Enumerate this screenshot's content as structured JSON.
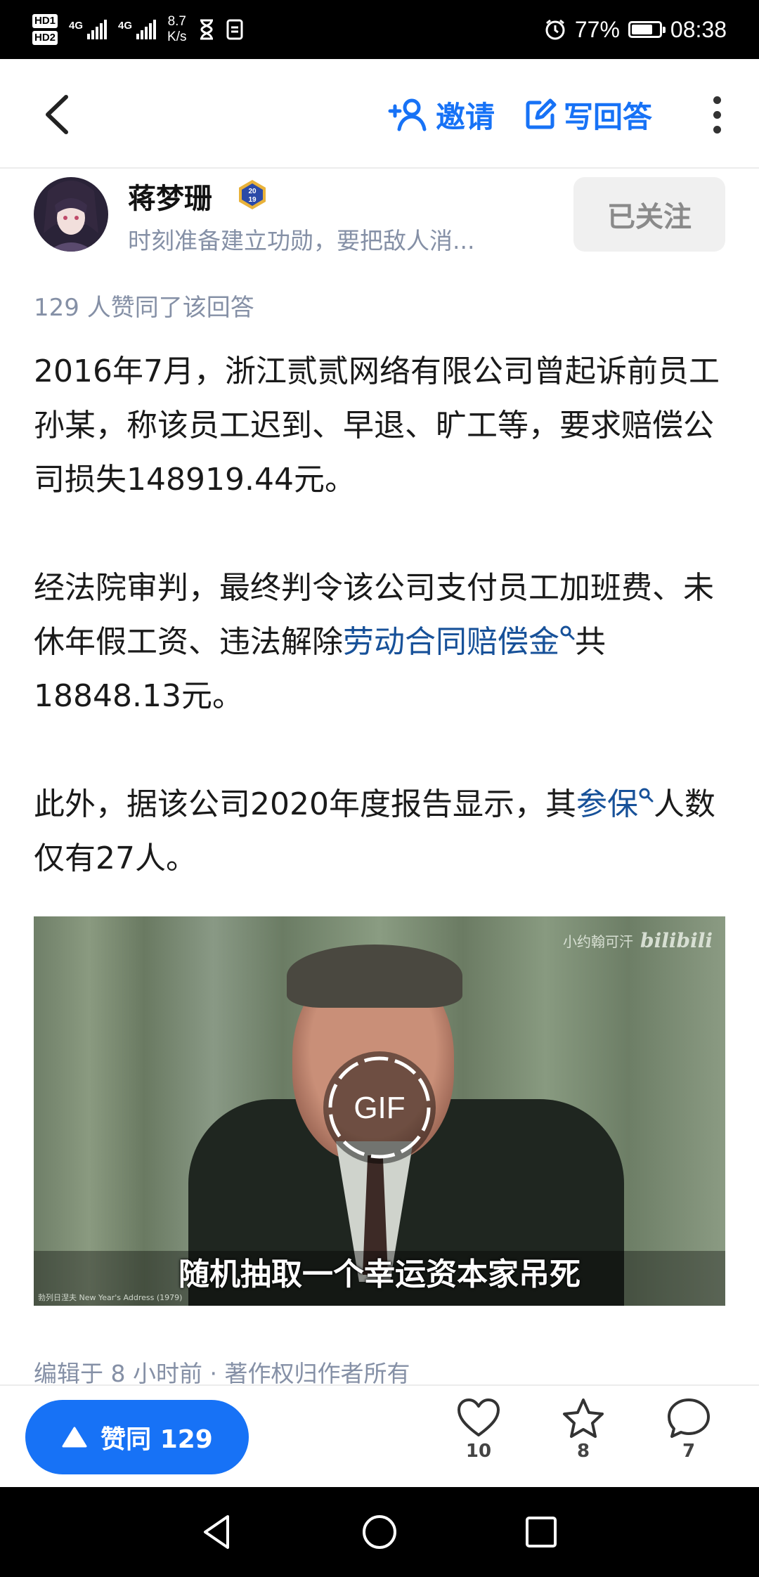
{
  "status_bar": {
    "hd1": "HD1",
    "hd2": "HD2",
    "network1": "4G",
    "network2": "4G",
    "speed_value": "8.7",
    "speed_unit": "K/s",
    "battery_percent": "77%",
    "battery_level": 0.77,
    "time": "08:38"
  },
  "top_bar": {
    "invite_label": "邀请",
    "write_answer_label": "写回答"
  },
  "author": {
    "name": "蒋梦珊",
    "badge_text": "2019",
    "bio": "时刻准备建立功勋，要把敌人消...",
    "follow_label": "已关注"
  },
  "agree_text": "129 人赞同了该回答",
  "content": {
    "p1": "2016年7月，浙江贰贰网络有限公司曾起诉前员工孙某，称该员工迟到、早退、旷工等，要求赔偿公司损失148919.44元。",
    "p2_before": "经法院审判，最终判令该公司支付员工加班费、未休年假工资、违法解除",
    "p2_link": "劳动合同赔偿金",
    "p2_after": "共18848.13元。",
    "p3_before": "此外，据该公司2020年度报告显示，其",
    "p3_link": "参保",
    "p3_after": "人数仅有27人。"
  },
  "gif": {
    "badge_label": "GIF",
    "caption": "随机抽取一个幸运资本家吊死",
    "watermark_user": "小约翰可汗",
    "watermark_brand": "bilibili",
    "small_text": "勃列日涅夫 New Year's Address (1979)"
  },
  "edited_text": "编辑于 8 小时前 · 著作权归作者所有",
  "bottom_bar": {
    "vote_label": "赞同 129",
    "like_count": "10",
    "favorite_count": "8",
    "comment_count": "7"
  },
  "colors": {
    "accent": "#1772f6",
    "link": "#175199",
    "meta": "#8590a6"
  }
}
